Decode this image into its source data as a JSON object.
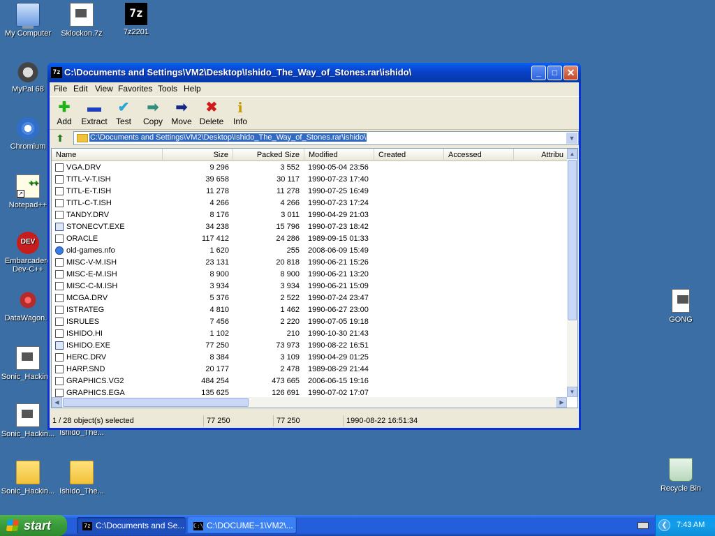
{
  "desktop": {
    "icons": [
      {
        "label": "My Computer"
      },
      {
        "label": "Sklockon.7z"
      },
      {
        "label": "7z2201"
      },
      {
        "label": "MyPal 68"
      },
      {
        "label": "Chromium"
      },
      {
        "label": "Notepad++"
      },
      {
        "label": "Embarcadero Dev-C++"
      },
      {
        "label": "DataWagon..."
      },
      {
        "label": "Sonic_Hackin..."
      },
      {
        "label": "Sonic_Hackin..."
      },
      {
        "label": "Ishido_The..."
      },
      {
        "label": "Sonic_Hackin..."
      },
      {
        "label": "Ishido_The..."
      },
      {
        "label": "GONG"
      },
      {
        "label": "Recycle Bin"
      }
    ],
    "dev_icon_text": "DEV"
  },
  "window": {
    "app_icon_text": "7z",
    "title": "C:\\Documents and Settings\\VM2\\Desktop\\Ishido_The_Way_of_Stones.rar\\ishido\\",
    "controls": {
      "minimize": "_",
      "maximize": "□",
      "close": "✕"
    },
    "menu": [
      "File",
      "Edit",
      "View",
      "Favorites",
      "Tools",
      "Help"
    ],
    "toolbar": [
      {
        "label": "Add",
        "icon": "plus-icon",
        "glyph": "✚",
        "color": "#1fb317"
      },
      {
        "label": "Extract",
        "icon": "minus-icon",
        "glyph": "▬",
        "color": "#1f3fbf"
      },
      {
        "label": "Test",
        "icon": "check-icon",
        "glyph": "✔",
        "color": "#27a7d6"
      },
      {
        "label": "Copy",
        "icon": "copy-arrow-icon",
        "glyph": "➡",
        "color": "#2f8f7c"
      },
      {
        "label": "Move",
        "icon": "move-arrow-icon",
        "glyph": "➡",
        "color": "#14278a"
      },
      {
        "label": "Delete",
        "icon": "delete-x-icon",
        "glyph": "✖",
        "color": "#d11a1a"
      },
      {
        "label": "Info",
        "icon": "info-icon",
        "glyph": "i",
        "color": "#c89b00"
      }
    ],
    "address": "C:\\Documents and Settings\\VM2\\Desktop\\Ishido_The_Way_of_Stones.rar\\ishido\\",
    "columns": [
      "Name",
      "Size",
      "Packed Size",
      "Modified",
      "Created",
      "Accessed",
      "Attribu"
    ],
    "files": [
      {
        "name": "VGA.DRV",
        "size": "9 296",
        "packed": "3 552",
        "modified": "1990-05-04 23:56",
        "type": "doc"
      },
      {
        "name": "TITL-V-T.ISH",
        "size": "39 658",
        "packed": "30 117",
        "modified": "1990-07-23 17:40",
        "type": "doc"
      },
      {
        "name": "TITL-E-T.ISH",
        "size": "11 278",
        "packed": "11 278",
        "modified": "1990-07-25 16:49",
        "type": "doc"
      },
      {
        "name": "TITL-C-T.ISH",
        "size": "4 266",
        "packed": "4 266",
        "modified": "1990-07-23 17:24",
        "type": "doc"
      },
      {
        "name": "TANDY.DRV",
        "size": "8 176",
        "packed": "3 011",
        "modified": "1990-04-29 21:03",
        "type": "doc"
      },
      {
        "name": "STONECVT.EXE",
        "size": "34 238",
        "packed": "15 796",
        "modified": "1990-07-23 18:42",
        "type": "exe"
      },
      {
        "name": "ORACLE",
        "size": "117 412",
        "packed": "24 286",
        "modified": "1989-09-15 01:33",
        "type": "doc"
      },
      {
        "name": "old-games.nfo",
        "size": "1 620",
        "packed": "255",
        "modified": "2008-06-09 15:49",
        "type": "info"
      },
      {
        "name": "MISC-V-M.ISH",
        "size": "23 131",
        "packed": "20 818",
        "modified": "1990-06-21 15:26",
        "type": "doc"
      },
      {
        "name": "MISC-E-M.ISH",
        "size": "8 900",
        "packed": "8 900",
        "modified": "1990-06-21 13:20",
        "type": "doc"
      },
      {
        "name": "MISC-C-M.ISH",
        "size": "3 934",
        "packed": "3 934",
        "modified": "1990-06-21 15:09",
        "type": "doc"
      },
      {
        "name": "MCGA.DRV",
        "size": "5 376",
        "packed": "2 522",
        "modified": "1990-07-24 23:47",
        "type": "doc"
      },
      {
        "name": "ISTRATEG",
        "size": "4 810",
        "packed": "1 462",
        "modified": "1990-06-27 23:00",
        "type": "doc"
      },
      {
        "name": "ISRULES",
        "size": "7 456",
        "packed": "2 220",
        "modified": "1990-07-05 19:18",
        "type": "doc"
      },
      {
        "name": "ISHIDO.HI",
        "size": "1 102",
        "packed": "210",
        "modified": "1990-10-30 21:43",
        "type": "doc"
      },
      {
        "name": "ISHIDO.EXE",
        "size": "77 250",
        "packed": "73 973",
        "modified": "1990-08-22 16:51",
        "type": "exe"
      },
      {
        "name": "HERC.DRV",
        "size": "8 384",
        "packed": "3 109",
        "modified": "1990-04-29 01:25",
        "type": "doc"
      },
      {
        "name": "HARP.SND",
        "size": "20 177",
        "packed": "2 478",
        "modified": "1989-08-29 21:44",
        "type": "doc"
      },
      {
        "name": "GRAPHICS.VG2",
        "size": "484 254",
        "packed": "473 665",
        "modified": "2006-06-15 19:16",
        "type": "doc"
      },
      {
        "name": "GRAPHICS.EGA",
        "size": "135 625",
        "packed": "126 691",
        "modified": "1990-07-02 17:07",
        "type": "doc"
      }
    ],
    "status": {
      "selection": "1 / 28 object(s) selected",
      "size": "77 250",
      "packed": "77 250",
      "modified": "1990-08-22 16:51:34"
    }
  },
  "taskbar": {
    "start_label": "start",
    "tasks": [
      {
        "label": "C:\\Documents and Se...",
        "icon_text": "7z"
      },
      {
        "label": "C:\\DOCUME~1\\VM2\\...",
        "icon_text": "C:\\"
      }
    ],
    "clock": "7:43 AM"
  },
  "colors": {
    "accent": "#0831d9",
    "selection": "#316ac5",
    "desktop": "#3a6ea5"
  }
}
